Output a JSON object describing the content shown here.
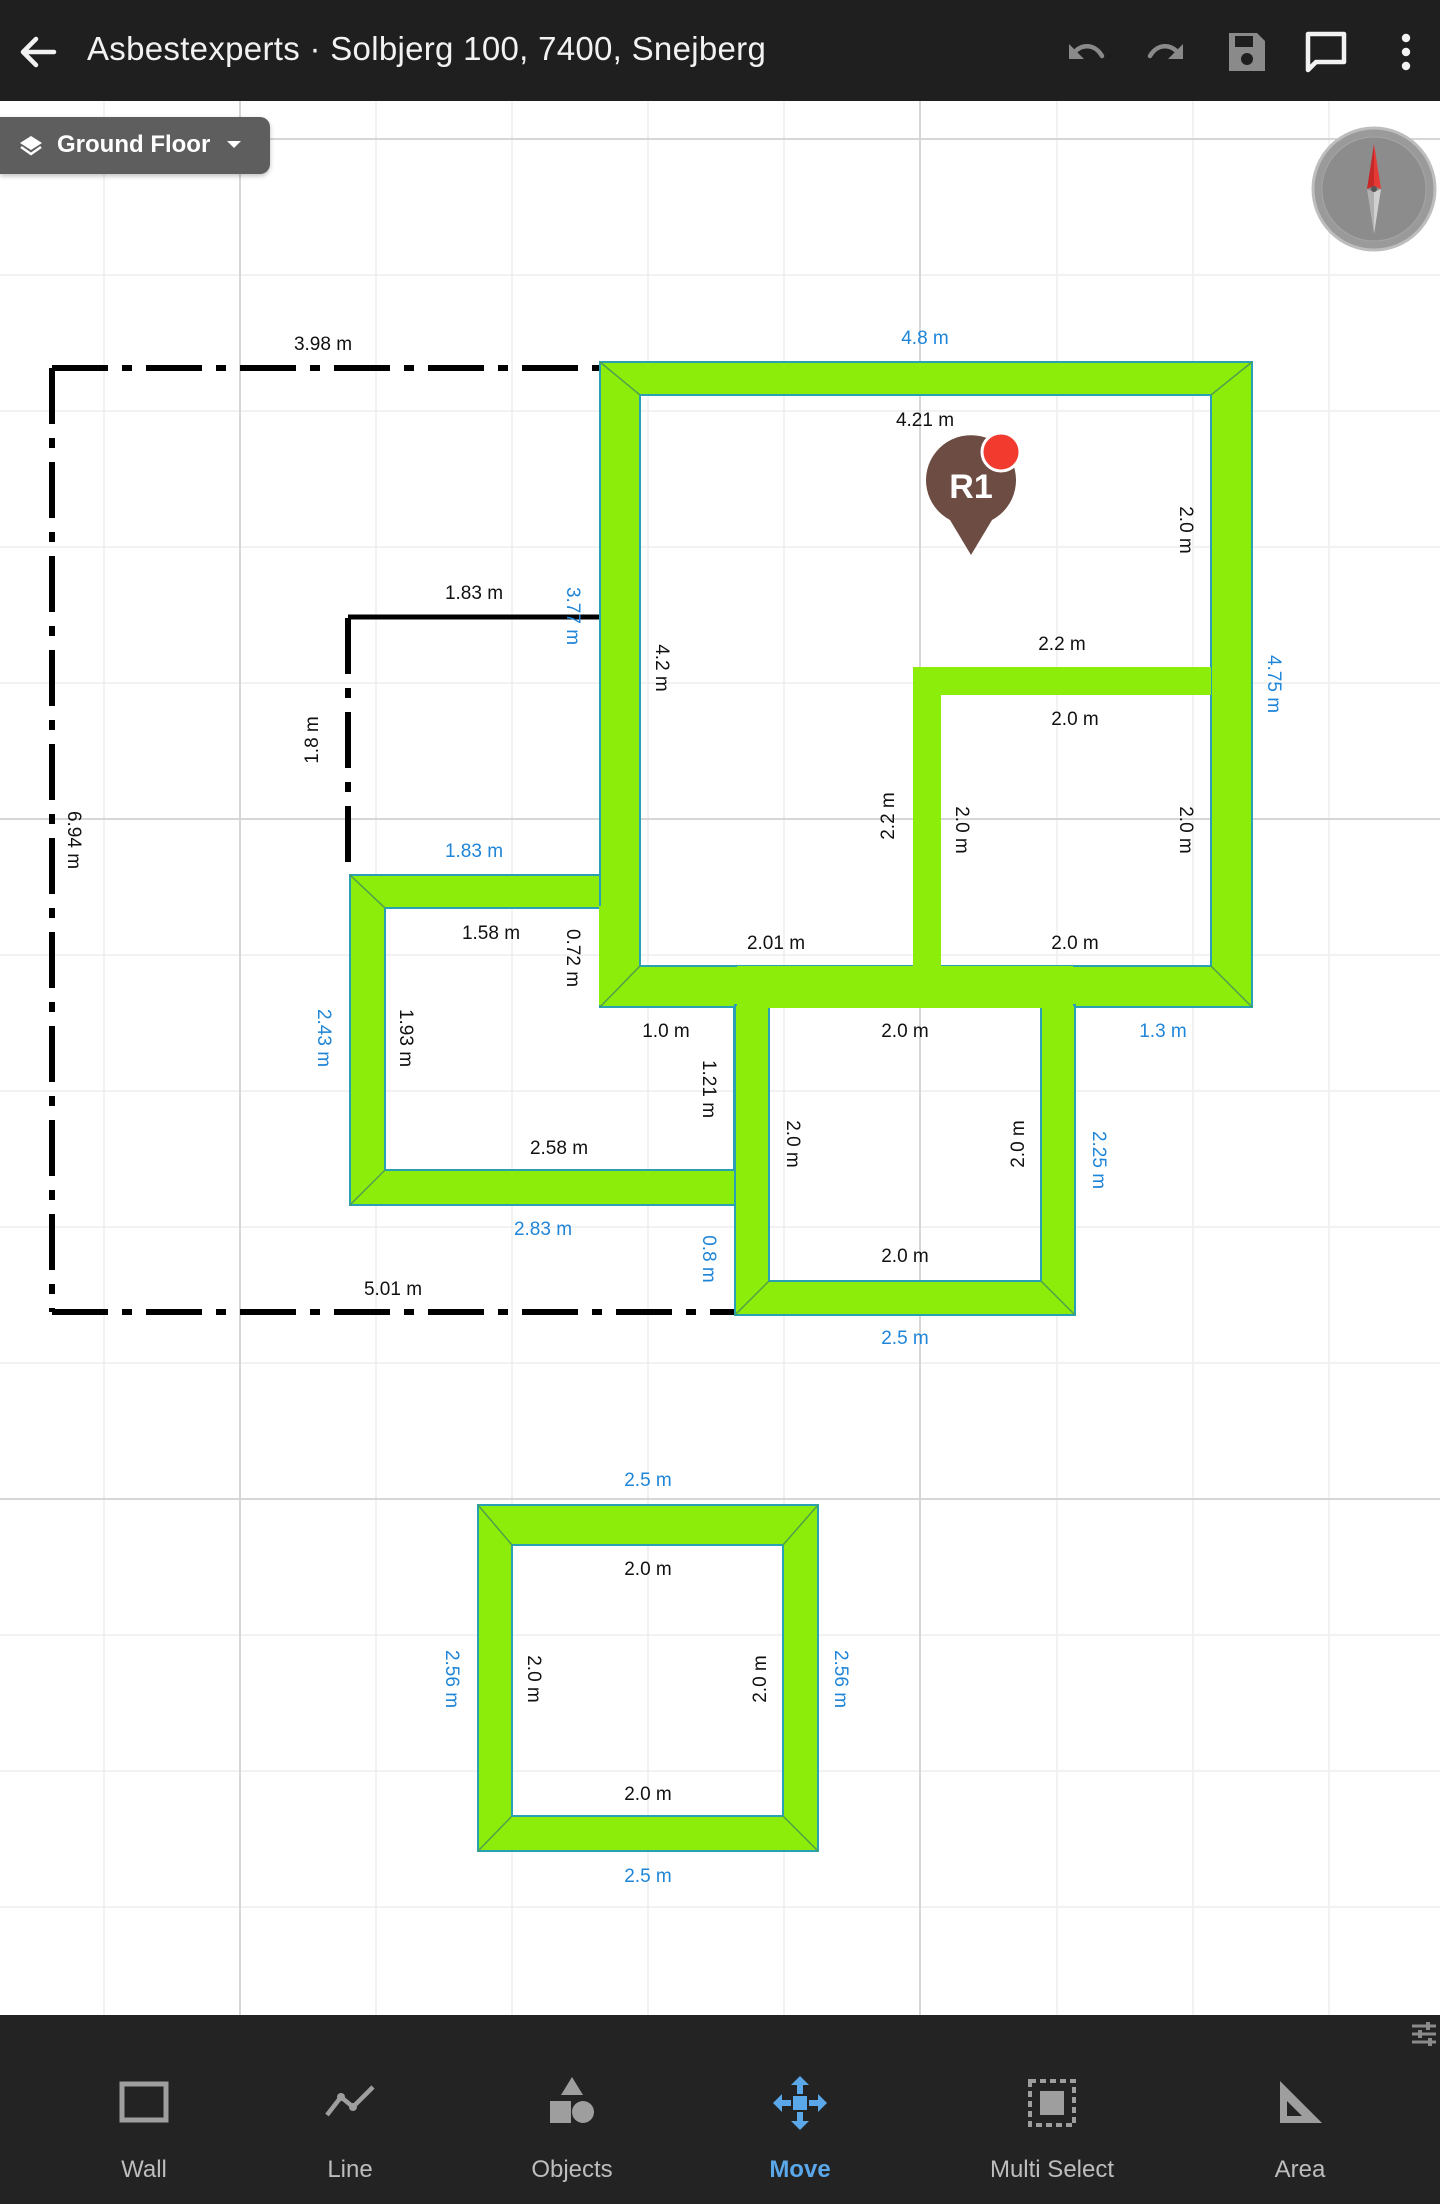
{
  "header": {
    "title": "Asbestexperts · Solbjerg 100, 7400, Snejberg",
    "icons": [
      "back-arrow-icon",
      "undo-icon",
      "redo-icon",
      "save-icon",
      "comment-icon",
      "more-vert-icon"
    ]
  },
  "floor_selector": {
    "label": "Ground Floor",
    "icon": "layers-icon"
  },
  "compass": {
    "icon": "compass-icon"
  },
  "colors": {
    "wall": "#8ced0a",
    "wall_outline": "#2aa0b5",
    "outer_measure": "#1f85d8",
    "inner_measure": "#000000",
    "pin": "#6d4c44",
    "pin_dot": "#f23a2f",
    "active_tool": "#5aa7ea"
  },
  "pin": {
    "label": "R1"
  },
  "measurements": {
    "m1": "4.8 m",
    "m2": "3.98 m",
    "m3": "4.21 m",
    "m4": "2.0 m",
    "m5": "1.83 m",
    "m6": "3.77 m",
    "m7": "4.2 m",
    "m8": "4.75 m",
    "m9": "2.2 m",
    "m10": "2.0 m",
    "m11": "1.8 m",
    "m12": "2.2 m",
    "m13": "2.0 m",
    "m14": "2.0 m",
    "m15": "6.94 m",
    "m16": "1.83 m",
    "m17": "1.58 m",
    "m18": "0.72 m",
    "m19": "2.01 m",
    "m20": "2.0 m",
    "m21": "2.43 m",
    "m22": "1.93 m",
    "m23": "1.0 m",
    "m24": "2.0 m",
    "m25": "1.3 m",
    "m26": "1.21 m",
    "m27": "2.0 m",
    "m28": "2.0 m",
    "m29": "2.25 m",
    "m30": "2.58 m",
    "m31": "2.83 m",
    "m32": "0.8 m",
    "m33": "2.0 m",
    "m34": "5.01 m",
    "m35": "2.5 m",
    "m36": "2.5 m",
    "m37": "2.0 m",
    "m38": "2.56 m",
    "m39": "2.0 m",
    "m40": "2.0 m",
    "m41": "2.56 m",
    "m42": "2.0 m",
    "m43": "2.5 m"
  },
  "toolbar": {
    "items": [
      {
        "label": "Wall",
        "icon": "wall-icon",
        "active": false
      },
      {
        "label": "Line",
        "icon": "line-icon",
        "active": false
      },
      {
        "label": "Objects",
        "icon": "objects-icon",
        "active": false
      },
      {
        "label": "Move",
        "icon": "move-icon",
        "active": true
      },
      {
        "label": "Multi Select",
        "icon": "multi-select-icon",
        "active": false
      },
      {
        "label": "Area",
        "icon": "area-icon",
        "active": false
      }
    ],
    "settings_icon": "tune-icon"
  }
}
